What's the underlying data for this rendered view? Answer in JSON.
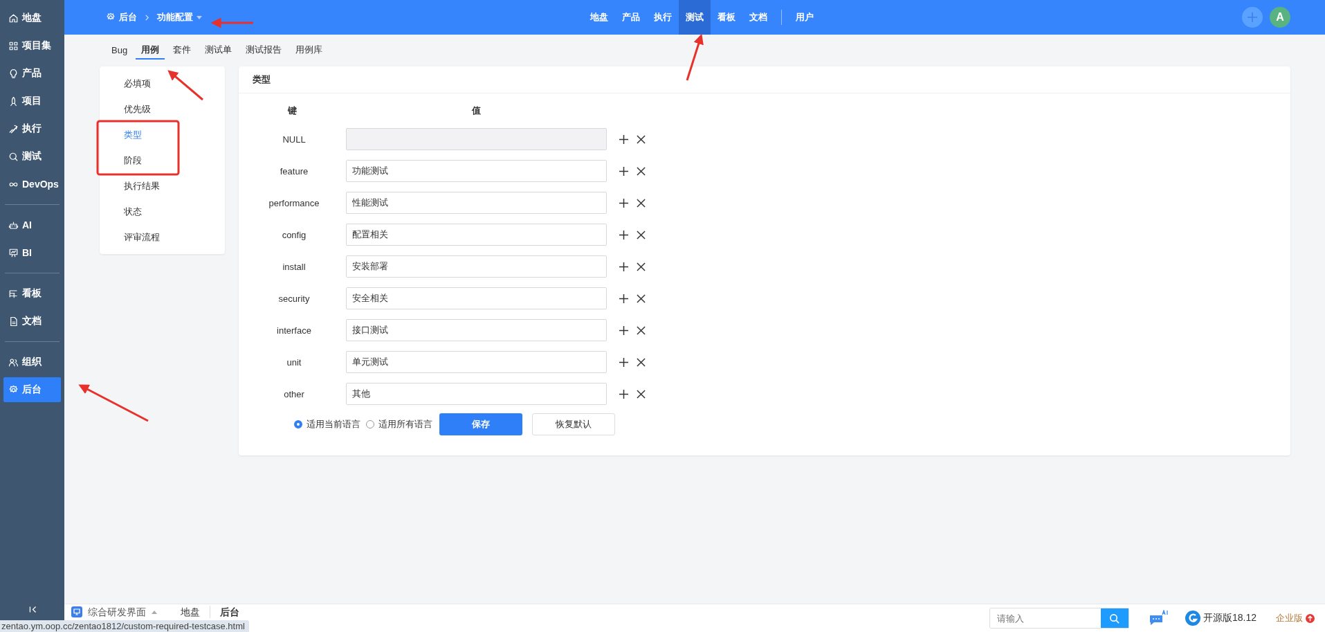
{
  "sidebar": {
    "groups": [
      [
        {
          "label": "地盘",
          "selected": false
        },
        {
          "label": "项目集",
          "selected": false
        },
        {
          "label": "产品",
          "selected": false
        },
        {
          "label": "项目",
          "selected": false
        },
        {
          "label": "执行",
          "selected": false
        },
        {
          "label": "测试",
          "selected": false
        },
        {
          "label": "DevOps",
          "selected": false
        }
      ],
      [
        {
          "label": "AI",
          "selected": false
        },
        {
          "label": "BI",
          "selected": false
        }
      ],
      [
        {
          "label": "看板",
          "selected": false
        },
        {
          "label": "文档",
          "selected": false
        }
      ],
      [
        {
          "label": "组织",
          "selected": false
        },
        {
          "label": "后台",
          "selected": true
        }
      ]
    ]
  },
  "breadcrumb": {
    "root": "后台",
    "current": "功能配置"
  },
  "top_nav": {
    "items": [
      {
        "label": "地盘",
        "selected": false
      },
      {
        "label": "产品",
        "selected": false
      },
      {
        "label": "执行",
        "selected": false
      },
      {
        "label": "测试",
        "selected": true
      },
      {
        "label": "看板",
        "selected": false
      },
      {
        "label": "文档",
        "selected": false
      }
    ],
    "extra": "用户"
  },
  "avatar": "A",
  "tabs": [
    {
      "label": "Bug",
      "selected": false
    },
    {
      "label": "用例",
      "selected": true
    },
    {
      "label": "套件",
      "selected": false
    },
    {
      "label": "测试单",
      "selected": false
    },
    {
      "label": "测试报告",
      "selected": false
    },
    {
      "label": "用例库",
      "selected": false
    }
  ],
  "left_menu": [
    {
      "label": "必填项",
      "selected": false
    },
    {
      "label": "优先级",
      "selected": false
    },
    {
      "label": "类型",
      "selected": true
    },
    {
      "label": "阶段",
      "selected": false
    },
    {
      "label": "执行结果",
      "selected": false
    },
    {
      "label": "状态",
      "selected": false
    },
    {
      "label": "评审流程",
      "selected": false
    }
  ],
  "panel": {
    "title": "类型",
    "key_header": "键",
    "value_header": "值",
    "rows": [
      {
        "key": "NULL",
        "disabled": true
      },
      {
        "key": "feature",
        "value": "功能测试",
        "disabled": false
      },
      {
        "key": "performance",
        "value": "性能测试",
        "disabled": false
      },
      {
        "key": "config",
        "value": "配置相关",
        "disabled": false
      },
      {
        "key": "install",
        "value": "安装部署",
        "disabled": false
      },
      {
        "key": "security",
        "value": "安全相关",
        "disabled": false
      },
      {
        "key": "interface",
        "value": "接口测试",
        "disabled": false
      },
      {
        "key": "unit",
        "value": "单元测试",
        "disabled": false
      },
      {
        "key": "other",
        "value": "其他",
        "disabled": false
      }
    ],
    "language_options": [
      {
        "label": "适用当前语言",
        "selected": true
      },
      {
        "label": "适用所有语言",
        "selected": false
      }
    ],
    "save_button": "保存",
    "restore_button": "恢复默认"
  },
  "bottom_bar": {
    "workspace": "综合研发界面",
    "crumbs": [
      "地盘",
      "后台"
    ],
    "search_placeholder": "请输入",
    "version": "开源版18.12",
    "enterprise": "企业版"
  },
  "status_url": "zentao.ym.oop.cc/zentao1812/custom-required-testcase.html"
}
